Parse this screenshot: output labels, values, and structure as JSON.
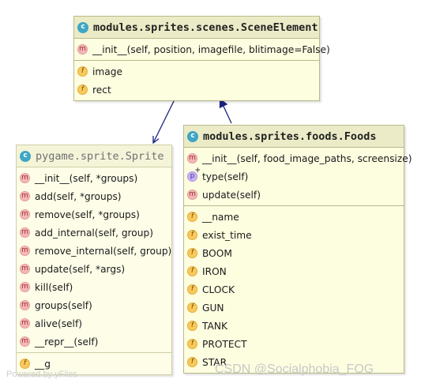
{
  "colors": {
    "class_fill": "#fdfde0",
    "class_header": "#ebebc7",
    "class_border": "#b9b98a",
    "edge": "#1a237e",
    "class_badge": "#3fa6c4",
    "method_badge": "#f4b7b7",
    "field_badge": "#f8c95c",
    "property_badge": "#c8b3f3"
  },
  "classes": {
    "scene_element": {
      "name": "modules.sprites.scenes.SceneElement",
      "methods": [
        "__init__(self, position, imagefile, blitimage=False)"
      ],
      "fields": [
        "image",
        "rect"
      ]
    },
    "sprite": {
      "name": "pygame.sprite.Sprite",
      "methods": [
        "__init__(self, *groups)",
        "add(self, *groups)",
        "remove(self, *groups)",
        "add_internal(self, group)",
        "remove_internal(self, group)",
        "update(self, *args)",
        "kill(self)",
        "groups(self)",
        "alive(self)",
        "__repr__(self)"
      ],
      "fields": [
        "__g"
      ]
    },
    "foods": {
      "name": "modules.sprites.foods.Foods",
      "methods": [
        "__init__(self, food_image_paths, screensize)",
        "type(self)",
        "update(self)"
      ],
      "fields": [
        "__name",
        "exist_time",
        "BOOM",
        "IRON",
        "CLOCK",
        "GUN",
        "TANK",
        "PROTECT",
        "STAR"
      ]
    }
  },
  "badges": {
    "class": "c",
    "method": "m",
    "field": "f",
    "property": "p"
  },
  "edges": [
    {
      "from": "scene_element",
      "to": "sprite",
      "style": "association"
    },
    {
      "from": "foods",
      "to": "scene_element",
      "style": "inheritance"
    }
  ],
  "watermarks": {
    "left": "Powered by yFiles",
    "right": "CSDN @Socialphobia_FOG"
  }
}
